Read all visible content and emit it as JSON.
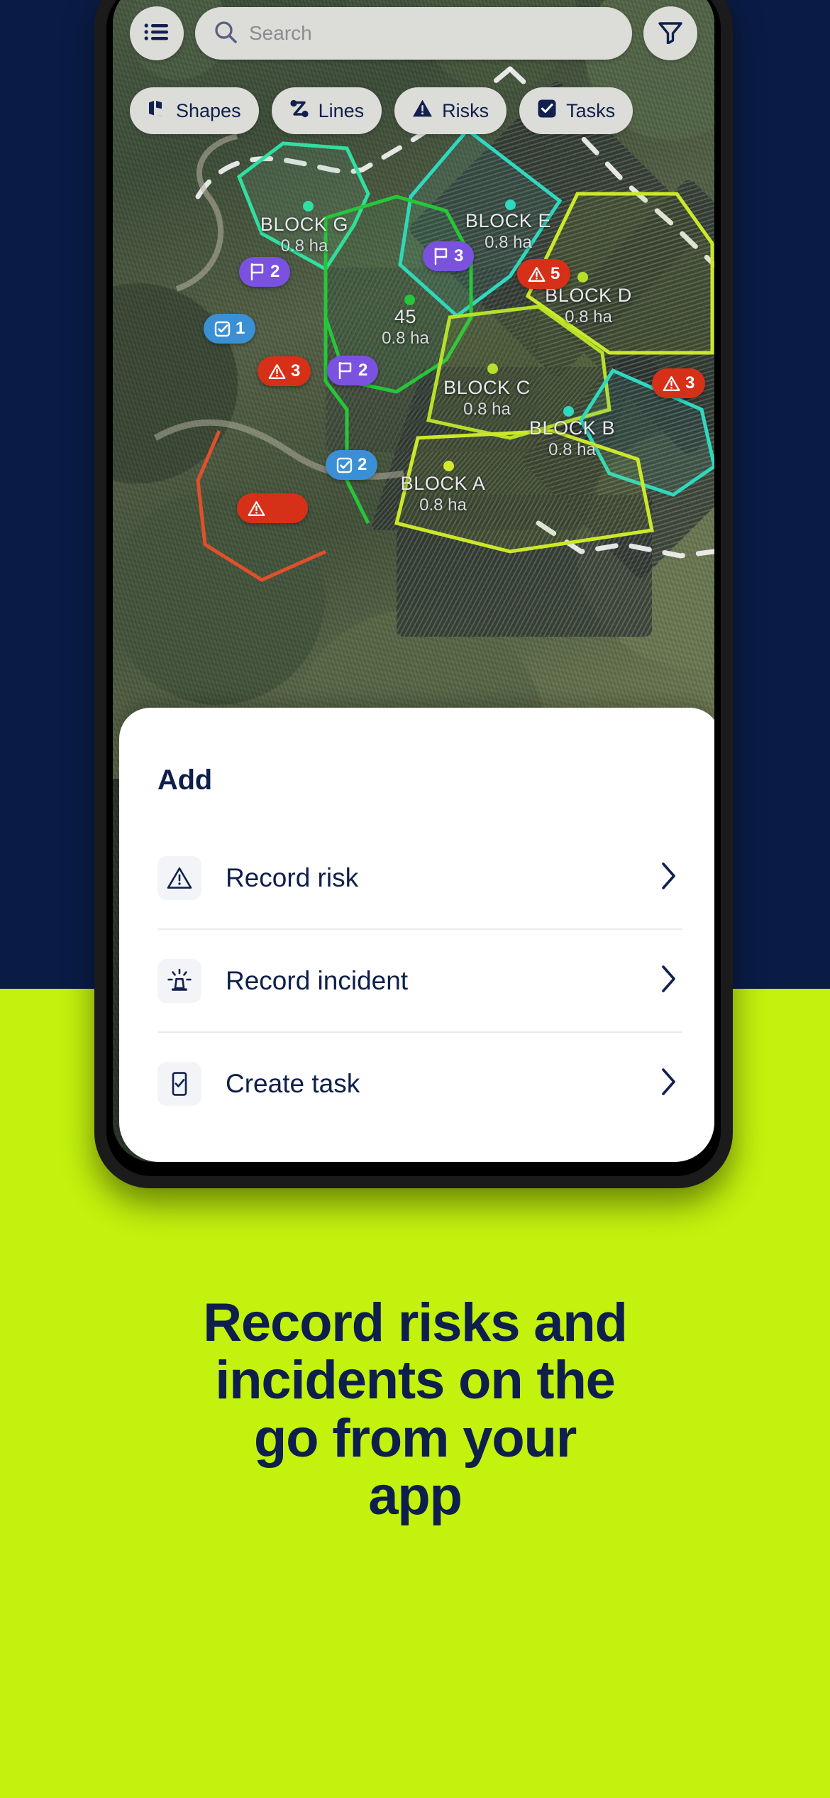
{
  "colors": {
    "navy": "#0a1c46",
    "lime": "#c2f20d",
    "chip_bg": "#dcdcd8",
    "risk_red": "#d63118",
    "flag_purple": "#7b52e0",
    "task_blue": "#3b8fd4",
    "sheet_white": "#ffffff"
  },
  "phone": {
    "topbar": {
      "menu_icon": "list-menu-icon",
      "filter_icon": "filter-funnel-icon",
      "search": {
        "icon": "search-icon",
        "placeholder": "Search",
        "value": ""
      }
    },
    "filter_chips": [
      {
        "label": "Shapes",
        "icon": "shapes-icon",
        "active": false
      },
      {
        "label": "Lines",
        "icon": "lines-icon",
        "active": false
      },
      {
        "label": "Risks",
        "icon": "risk-triangle-icon",
        "active": false
      },
      {
        "label": "Tasks",
        "icon": "task-checkbox-icon",
        "active": true
      }
    ],
    "map": {
      "blocks": [
        {
          "name": "BLOCK G",
          "area": "0.8 ha",
          "dot_color": "#2fe0a0",
          "outline": "#2fe0a0"
        },
        {
          "name": "BLOCK E",
          "area": "0.8 ha",
          "dot_color": "#2fd9c0",
          "outline": "#2fd9c0"
        },
        {
          "name": "BLOCK D",
          "area": "0.8 ha",
          "dot_color": "#b6e02a",
          "outline": "#cbe82a"
        },
        {
          "name": "45",
          "area": "0.8 ha",
          "dot_color": "#27c63a",
          "outline": "#27c63a"
        },
        {
          "name": "BLOCK C",
          "area": "0.8 ha",
          "dot_color": "#b6e02a",
          "outline": "#b6e02a"
        },
        {
          "name": "BLOCK B",
          "area": "0.8 ha",
          "dot_color": "#2fd9c0",
          "outline": "#2fd9c0"
        },
        {
          "name": "BLOCK A",
          "area": "0.8 ha",
          "dot_color": "#d5e82a",
          "outline": "#cbe82a"
        }
      ],
      "badges": [
        {
          "type": "flag",
          "count": "2",
          "icon": "flag-icon"
        },
        {
          "type": "task",
          "count": "1",
          "icon": "task-checkbox-icon"
        },
        {
          "type": "flag",
          "count": "3",
          "icon": "flag-icon"
        },
        {
          "type": "risk",
          "count": "5",
          "icon": "risk-triangle-icon"
        },
        {
          "type": "risk",
          "count": "3",
          "icon": "risk-triangle-icon"
        },
        {
          "type": "flag",
          "count": "2",
          "icon": "flag-icon"
        },
        {
          "type": "risk",
          "count": "3",
          "icon": "risk-triangle-icon"
        },
        {
          "type": "task",
          "count": "2",
          "icon": "task-checkbox-icon"
        }
      ]
    },
    "sheet": {
      "title": "Add",
      "items": [
        {
          "label": "Record risk",
          "icon": "risk-triangle-icon",
          "chevron": "chevron-right-icon"
        },
        {
          "label": "Record incident",
          "icon": "incident-siren-icon",
          "chevron": "chevron-right-icon"
        },
        {
          "label": "Create task",
          "icon": "task-checkbox-icon",
          "chevron": "chevron-right-icon"
        }
      ]
    }
  },
  "headline": {
    "line1": "Record risks and",
    "line2": "incidents on the",
    "line3": "go from your",
    "line4": "app"
  }
}
